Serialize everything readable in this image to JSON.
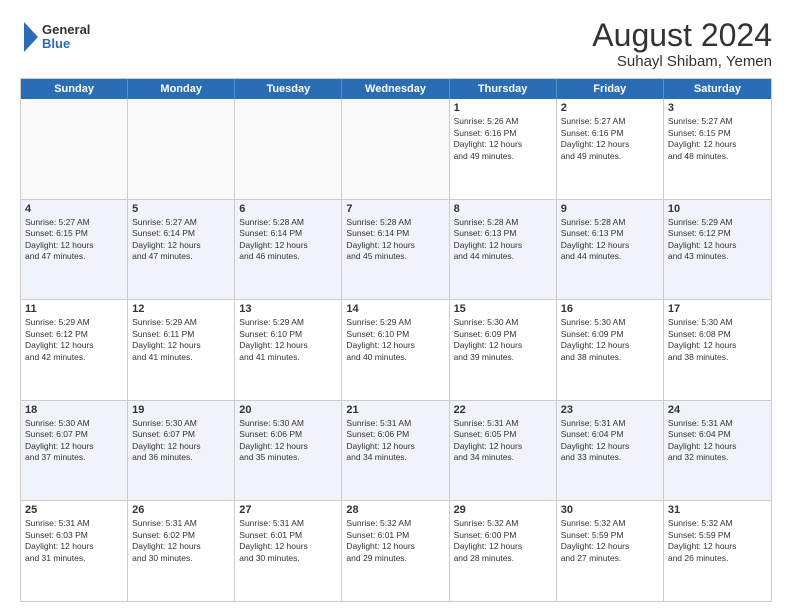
{
  "header": {
    "logo_general": "General",
    "logo_blue": "Blue",
    "month_year": "August 2024",
    "location": "Suhayl Shibam, Yemen"
  },
  "days_of_week": [
    "Sunday",
    "Monday",
    "Tuesday",
    "Wednesday",
    "Thursday",
    "Friday",
    "Saturday"
  ],
  "weeks": [
    [
      {
        "day": "",
        "empty": true
      },
      {
        "day": "",
        "empty": true
      },
      {
        "day": "",
        "empty": true
      },
      {
        "day": "",
        "empty": true
      },
      {
        "day": "1",
        "info": "Sunrise: 5:26 AM\nSunset: 6:16 PM\nDaylight: 12 hours\nand 49 minutes."
      },
      {
        "day": "2",
        "info": "Sunrise: 5:27 AM\nSunset: 6:16 PM\nDaylight: 12 hours\nand 49 minutes."
      },
      {
        "day": "3",
        "info": "Sunrise: 5:27 AM\nSunset: 6:15 PM\nDaylight: 12 hours\nand 48 minutes."
      }
    ],
    [
      {
        "day": "4",
        "info": "Sunrise: 5:27 AM\nSunset: 6:15 PM\nDaylight: 12 hours\nand 47 minutes."
      },
      {
        "day": "5",
        "info": "Sunrise: 5:27 AM\nSunset: 6:14 PM\nDaylight: 12 hours\nand 47 minutes."
      },
      {
        "day": "6",
        "info": "Sunrise: 5:28 AM\nSunset: 6:14 PM\nDaylight: 12 hours\nand 46 minutes."
      },
      {
        "day": "7",
        "info": "Sunrise: 5:28 AM\nSunset: 6:14 PM\nDaylight: 12 hours\nand 45 minutes."
      },
      {
        "day": "8",
        "info": "Sunrise: 5:28 AM\nSunset: 6:13 PM\nDaylight: 12 hours\nand 44 minutes."
      },
      {
        "day": "9",
        "info": "Sunrise: 5:28 AM\nSunset: 6:13 PM\nDaylight: 12 hours\nand 44 minutes."
      },
      {
        "day": "10",
        "info": "Sunrise: 5:29 AM\nSunset: 6:12 PM\nDaylight: 12 hours\nand 43 minutes."
      }
    ],
    [
      {
        "day": "11",
        "info": "Sunrise: 5:29 AM\nSunset: 6:12 PM\nDaylight: 12 hours\nand 42 minutes."
      },
      {
        "day": "12",
        "info": "Sunrise: 5:29 AM\nSunset: 6:11 PM\nDaylight: 12 hours\nand 41 minutes."
      },
      {
        "day": "13",
        "info": "Sunrise: 5:29 AM\nSunset: 6:10 PM\nDaylight: 12 hours\nand 41 minutes."
      },
      {
        "day": "14",
        "info": "Sunrise: 5:29 AM\nSunset: 6:10 PM\nDaylight: 12 hours\nand 40 minutes."
      },
      {
        "day": "15",
        "info": "Sunrise: 5:30 AM\nSunset: 6:09 PM\nDaylight: 12 hours\nand 39 minutes."
      },
      {
        "day": "16",
        "info": "Sunrise: 5:30 AM\nSunset: 6:09 PM\nDaylight: 12 hours\nand 38 minutes."
      },
      {
        "day": "17",
        "info": "Sunrise: 5:30 AM\nSunset: 6:08 PM\nDaylight: 12 hours\nand 38 minutes."
      }
    ],
    [
      {
        "day": "18",
        "info": "Sunrise: 5:30 AM\nSunset: 6:07 PM\nDaylight: 12 hours\nand 37 minutes."
      },
      {
        "day": "19",
        "info": "Sunrise: 5:30 AM\nSunset: 6:07 PM\nDaylight: 12 hours\nand 36 minutes."
      },
      {
        "day": "20",
        "info": "Sunrise: 5:30 AM\nSunset: 6:06 PM\nDaylight: 12 hours\nand 35 minutes."
      },
      {
        "day": "21",
        "info": "Sunrise: 5:31 AM\nSunset: 6:06 PM\nDaylight: 12 hours\nand 34 minutes."
      },
      {
        "day": "22",
        "info": "Sunrise: 5:31 AM\nSunset: 6:05 PM\nDaylight: 12 hours\nand 34 minutes."
      },
      {
        "day": "23",
        "info": "Sunrise: 5:31 AM\nSunset: 6:04 PM\nDaylight: 12 hours\nand 33 minutes."
      },
      {
        "day": "24",
        "info": "Sunrise: 5:31 AM\nSunset: 6:04 PM\nDaylight: 12 hours\nand 32 minutes."
      }
    ],
    [
      {
        "day": "25",
        "info": "Sunrise: 5:31 AM\nSunset: 6:03 PM\nDaylight: 12 hours\nand 31 minutes."
      },
      {
        "day": "26",
        "info": "Sunrise: 5:31 AM\nSunset: 6:02 PM\nDaylight: 12 hours\nand 30 minutes."
      },
      {
        "day": "27",
        "info": "Sunrise: 5:31 AM\nSunset: 6:01 PM\nDaylight: 12 hours\nand 30 minutes."
      },
      {
        "day": "28",
        "info": "Sunrise: 5:32 AM\nSunset: 6:01 PM\nDaylight: 12 hours\nand 29 minutes."
      },
      {
        "day": "29",
        "info": "Sunrise: 5:32 AM\nSunset: 6:00 PM\nDaylight: 12 hours\nand 28 minutes."
      },
      {
        "day": "30",
        "info": "Sunrise: 5:32 AM\nSunset: 5:59 PM\nDaylight: 12 hours\nand 27 minutes."
      },
      {
        "day": "31",
        "info": "Sunrise: 5:32 AM\nSunset: 5:59 PM\nDaylight: 12 hours\nand 26 minutes."
      }
    ]
  ]
}
